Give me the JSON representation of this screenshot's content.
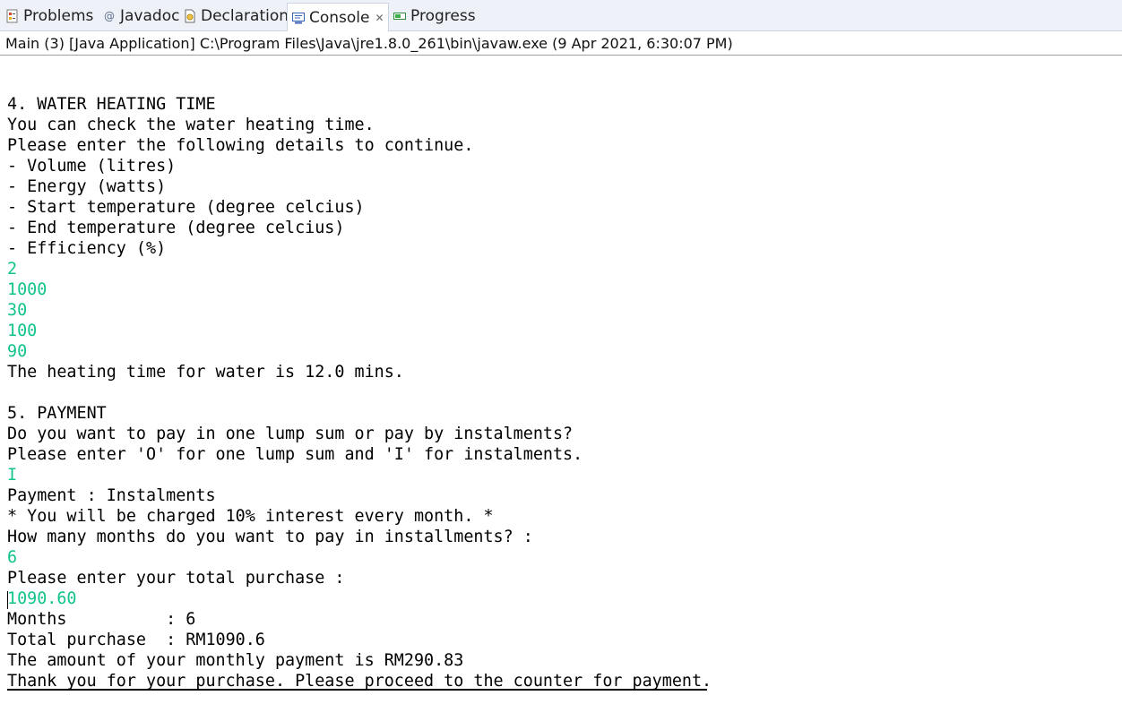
{
  "tabs": [
    {
      "label": "Problems",
      "icon": "problems-icon",
      "active": false
    },
    {
      "label": "Javadoc",
      "icon": "javadoc-icon",
      "active": false
    },
    {
      "label": "Declaration",
      "icon": "declaration-icon",
      "active": false
    },
    {
      "label": "Console",
      "icon": "console-icon",
      "active": true,
      "close": "✕"
    },
    {
      "label": "Progress",
      "icon": "progress-icon",
      "active": false
    }
  ],
  "console_header": "Main (3) [Java Application] C:\\Program Files\\Java\\jre1.8.0_261\\bin\\javaw.exe (9 Apr 2021, 6:30:07 PM)",
  "colors": {
    "input_text": "#12c38c",
    "tab_bar": "#eef2f8"
  },
  "console_lines": [
    {
      "text": "",
      "type": "output"
    },
    {
      "text": "4. WATER HEATING TIME",
      "type": "output"
    },
    {
      "text": "You can check the water heating time.",
      "type": "output"
    },
    {
      "text": "Please enter the following details to continue.",
      "type": "output"
    },
    {
      "text": "- Volume (litres)",
      "type": "output"
    },
    {
      "text": "- Energy (watts)",
      "type": "output"
    },
    {
      "text": "- Start temperature (degree celcius)",
      "type": "output"
    },
    {
      "text": "- End temperature (degree celcius)",
      "type": "output"
    },
    {
      "text": "- Efficiency (%)",
      "type": "output"
    },
    {
      "text": "2",
      "type": "input"
    },
    {
      "text": "1000",
      "type": "input"
    },
    {
      "text": "30",
      "type": "input"
    },
    {
      "text": "100",
      "type": "input"
    },
    {
      "text": "90",
      "type": "input"
    },
    {
      "text": "The heating time for water is 12.0 mins.",
      "type": "output"
    },
    {
      "text": "",
      "type": "output"
    },
    {
      "text": "5. PAYMENT",
      "type": "output"
    },
    {
      "text": "Do you want to pay in one lump sum or pay by instalments?",
      "type": "output"
    },
    {
      "text": "Please enter 'O' for one lump sum and 'I' for instalments.",
      "type": "output"
    },
    {
      "text": "I",
      "type": "input"
    },
    {
      "text": "Payment : Instalments",
      "type": "output"
    },
    {
      "text": "* You will be charged 10% interest every month. *",
      "type": "output"
    },
    {
      "text": "How many months do you want to pay in installments? :",
      "type": "output"
    },
    {
      "text": "6",
      "type": "input"
    },
    {
      "text": "Please enter your total purchase :",
      "type": "output"
    },
    {
      "text": "1090.60",
      "type": "input"
    },
    {
      "text": "Months          : 6",
      "type": "output"
    },
    {
      "text": "Total purchase  : RM1090.6",
      "type": "output"
    },
    {
      "text": "The amount of your monthly payment is RM290.83",
      "type": "output"
    },
    {
      "text": "Thank you for your purchase. Please proceed to the counter for payment.",
      "type": "output"
    }
  ]
}
